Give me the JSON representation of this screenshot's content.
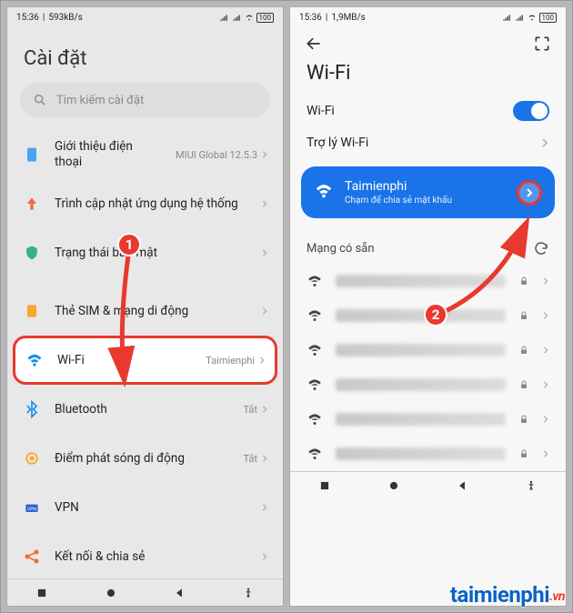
{
  "statusbar": {
    "left_time": "15:36",
    "left_speed_a": "593kB/s",
    "left_speed_b": "1,9MB/s",
    "battery": "100"
  },
  "left": {
    "title": "Cài đặt",
    "search_placeholder": "Tìm kiếm cài đặt",
    "items": {
      "about": {
        "label": "Giới thiệu điện thoại",
        "trail": "MIUI Global 12.5.3"
      },
      "update": {
        "label": "Trình cập nhật ứng dụng hệ thống"
      },
      "security": {
        "label": "Trạng thái bảo mật"
      },
      "sim": {
        "label": "Thẻ SIM & mạng di động"
      },
      "wifi": {
        "label": "Wi-Fi",
        "trail": "Taimienphi"
      },
      "bluetooth": {
        "label": "Bluetooth",
        "trail": "Tắt"
      },
      "hotspot": {
        "label": "Điểm phát sóng di động",
        "trail": "Tắt"
      },
      "vpn": {
        "label": "VPN"
      },
      "share": {
        "label": "Kết nối & chia sẻ"
      }
    }
  },
  "right": {
    "title": "Wi-Fi",
    "wifi_label": "Wi-Fi",
    "assist_label": "Trợ lý Wi-Fi",
    "connected": {
      "name": "Taimienphi",
      "sub": "Chạm để chia sẻ mật khẩu"
    },
    "avail_header": "Mạng có sẵn"
  },
  "annotations": {
    "badge1": "1",
    "badge2": "2"
  },
  "watermark": {
    "main": "taimienphi",
    "suffix": ".vn"
  }
}
